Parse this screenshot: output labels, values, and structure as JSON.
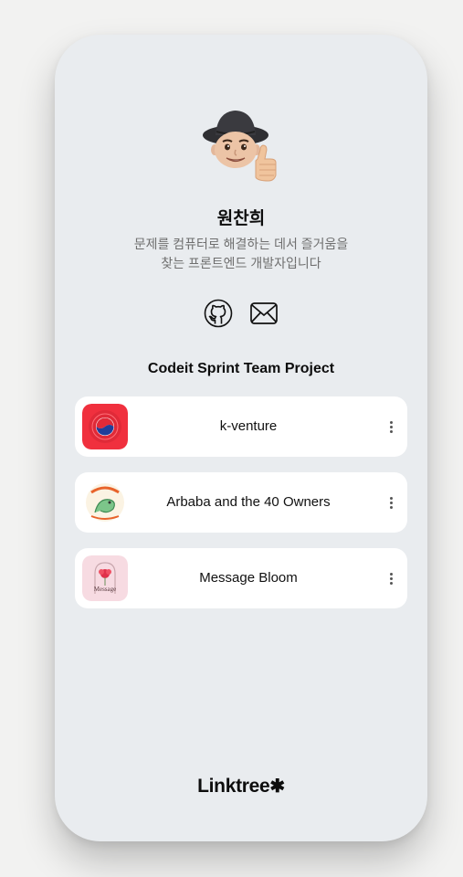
{
  "profile": {
    "name": "원찬희",
    "bio": "문제를 컴퓨터로 해결하는 데서 즐거움을 찾는 프론트엔드 개발자입니다"
  },
  "socials": [
    {
      "icon": "github-icon"
    },
    {
      "icon": "mail-icon"
    }
  ],
  "section": {
    "title": "Codeit Sprint Team Project"
  },
  "links": [
    {
      "label": "k-venture",
      "thumb": "k-venture-logo"
    },
    {
      "label": "Arbaba and the 40 Owners",
      "thumb": "arbaba-logo"
    },
    {
      "label": "Message Bloom",
      "thumb": "message-bloom-logo",
      "thumb_text": "Message"
    }
  ],
  "footer": {
    "brand": "Linktree",
    "mark": "✱"
  },
  "colors": {
    "page_bg": "#f2f2f1",
    "card_bg": "#e9ecef",
    "link_bg": "#ffffff",
    "k_venture_red": "#f0303e",
    "bloom_pink": "#f7dbe2"
  }
}
